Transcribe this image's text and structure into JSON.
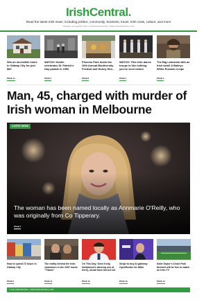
{
  "site": {
    "logo_part1": "Irish",
    "logo_part2": "Central",
    "logo_dot": ".",
    "tagline": "Read the latest Irish news, including politics, community, business, travel, Irish roots, culture, and more",
    "dateline": "TUESDAY 20 AUGUST 2024 | COMPLETE EDITION | WWW.IRISHCENTRAL.COM"
  },
  "top_stories": [
    {
      "title": "Win an incredible home in Galway City for just $60",
      "category": "PAGE 14"
    },
    {
      "title": "WATCH: Dublin celebrates St. Patrick's Day parade in 1950",
      "category": "PAGE 3"
    },
    {
      "title": "Phoenix Park hosts the 10th Annual Biodiversity Festival and Honey Sho...",
      "category": "PAGE 8"
    },
    {
      "title": "WATCH: This Irish dance troupe is like nothing you've seen before",
      "category": "PAGE 4"
    },
    {
      "title": "The Big Lebowski with an Irish twist! A Baileys White Russian recipe",
      "category": "PAGE 6"
    }
  ],
  "headline": "Man, 45, charged with murder of Irish woman in Melbourne",
  "hero": {
    "badge": "LATEST NEWS",
    "caption": "The woman has been named locally as Annmarie O'Reilly, who was originally from Co Tipperary.",
    "category": "PAGE 2"
  },
  "more_stories": [
    {
      "title": "How to spend 72 hours in Galway City",
      "category": "PAGE 5"
    },
    {
      "title": "The reality behind the Irish characters in the 1997 movie \"Titanic\"",
      "category": "PAGE 11"
    },
    {
      "title": "On This Day: Gene Kelly, Hollywood's dancing son of Derry, would have turned 114",
      "category": "PAGE 12"
    },
    {
      "title": "Stripe to buy AI gateway OpenRouter for $8bn",
      "category": "PAGE 13"
    },
    {
      "title": "Katie Taylor's Croke Park farewell will be free to watch on Irish TV",
      "category": "PAGE 14"
    }
  ],
  "footer": {
    "text": "© 2024 IRISHCENTRAL · WWW.IRISHCENTRAL.COM"
  },
  "colors": {
    "brand_green": "#2f9e3e",
    "text_dark": "#111111"
  }
}
